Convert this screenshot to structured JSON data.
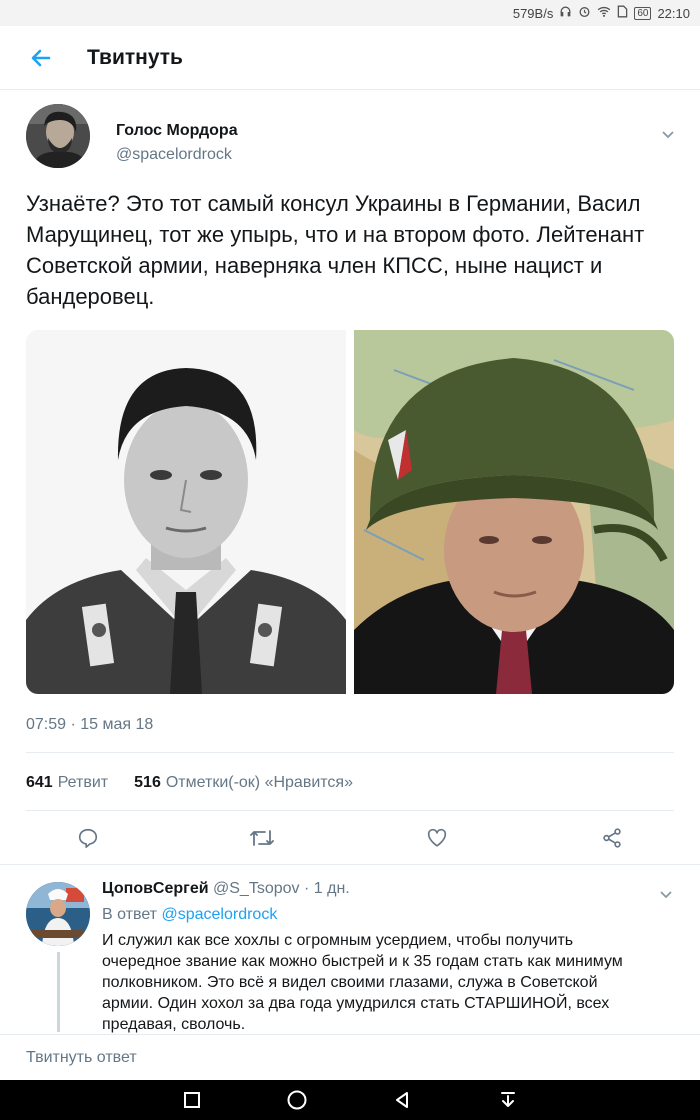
{
  "status_bar": {
    "net_speed": "579B/s",
    "battery": "60",
    "time": "22:10"
  },
  "header": {
    "title": "Твитнуть"
  },
  "tweet": {
    "author_name": "Голос Мордора",
    "author_handle": "@spacelordrock",
    "text": "Узнаёте? Это тот самый консул Украины в Германии, Васил Марущинец, тот же упырь, что и на втором фото. Лейтенант Советской армии, наверняка член КПСС, ныне нацист и бандеровец.",
    "timestamp": "07:59 · 15 мая 18",
    "retweet_count": "641",
    "retweet_label": "Ретвит",
    "like_count": "516",
    "like_label": "Отметки(-ок) «Нравится»"
  },
  "reply": {
    "author_name": "ЦоповСергей",
    "author_handle": "@S_Tsopov",
    "age": "· 1 дн.",
    "reply_prefix": "В ответ",
    "reply_to": "@spacelordrock",
    "text": "И служил как все хохлы с огромным усердием, чтобы получить очередное звание как можно быстрей и к 35 годам стать как минимум полковником. Это всё я видел своими глазами, служа в Советской армии. Один хохол за два года умудрился стать СТАРШИНОЙ, всех предавая, сволочь."
  },
  "compose": {
    "placeholder": "Твитнуть ответ"
  },
  "colors": {
    "accent": "#1da1f2",
    "secondary_text": "#657786",
    "divider": "#e6ecf0"
  }
}
